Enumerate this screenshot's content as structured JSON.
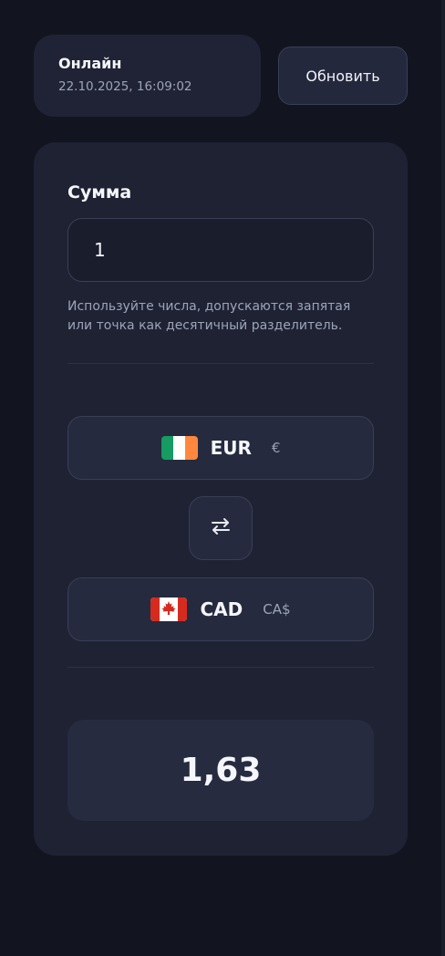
{
  "status": {
    "title": "Онлайн",
    "timestamp": "22.10.2025, 16:09:02"
  },
  "refresh_label": "Обновить",
  "amount": {
    "label": "Сумма",
    "value": "1",
    "hint": "Используйте числа, допускаются запятая или точка как десятичный разделитель."
  },
  "from_currency": {
    "code": "EUR",
    "symbol": "€",
    "flag_icon": "ireland-flag-icon"
  },
  "to_currency": {
    "code": "CAD",
    "symbol": "CA$",
    "flag_icon": "canada-flag-icon"
  },
  "swap_icon": "swap-arrows-icon",
  "result": "1,63",
  "colors": {
    "background": "#121520",
    "card": "#1e2233",
    "border": "#3a3f56",
    "muted_text": "#9ea4b8"
  }
}
